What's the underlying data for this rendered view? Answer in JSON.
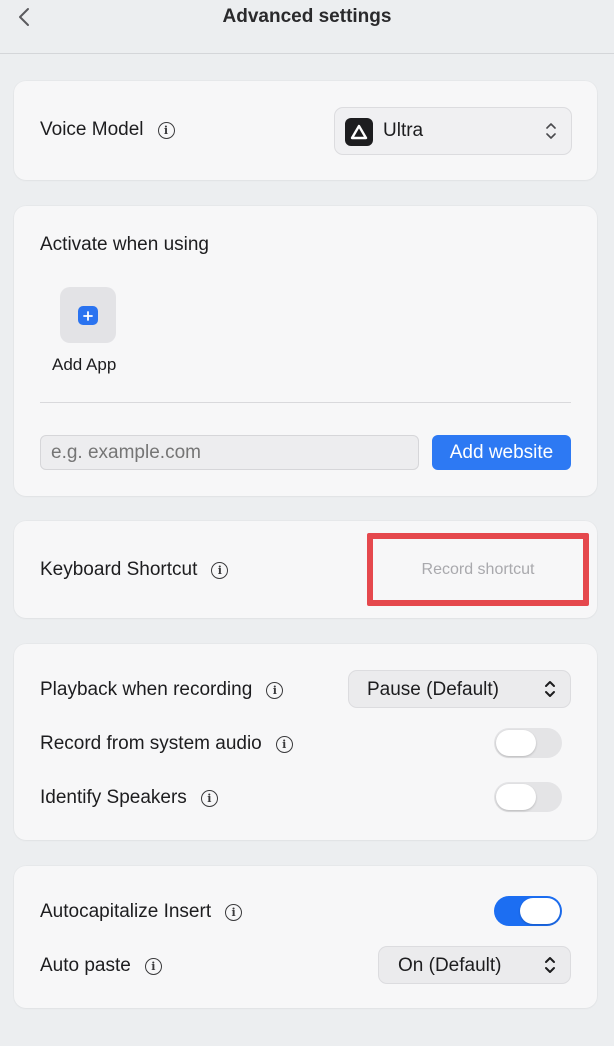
{
  "header": {
    "title": "Advanced settings"
  },
  "voice_model": {
    "label": "Voice Model",
    "value": "Ultra"
  },
  "activate": {
    "title": "Activate when using",
    "add_app_label": "Add App",
    "website_placeholder": "e.g. example.com",
    "add_website_label": "Add website"
  },
  "shortcut": {
    "label": "Keyboard Shortcut",
    "record_label": "Record shortcut"
  },
  "playback": {
    "label": "Playback when recording",
    "value": "Pause (Default)",
    "system_audio_label": "Record from system audio",
    "system_audio_on": false,
    "speakers_label": "Identify Speakers",
    "speakers_on": false
  },
  "insert": {
    "autocap_label": "Autocapitalize Insert",
    "autocap_on": true,
    "auto_paste_label": "Auto paste",
    "auto_paste_value": "On (Default)"
  },
  "colors": {
    "accent": "#1c6ef2",
    "highlight": "#e5484d"
  }
}
